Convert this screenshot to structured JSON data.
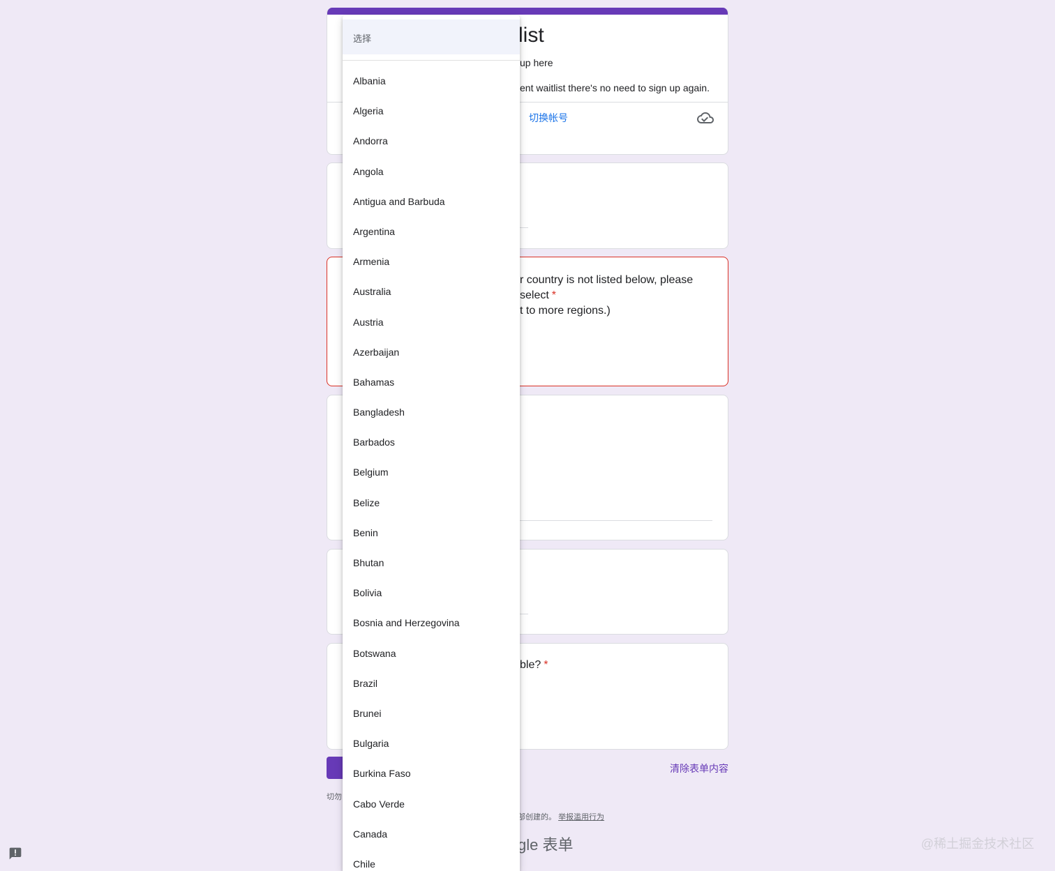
{
  "form": {
    "title_fragment": "list",
    "desc_line1_fragment": "up here",
    "desc_line2_fragment": "ent waitlist there's no need to sign up again.",
    "switch_account": "切换帐号",
    "q3_line1_fragment": "r country is not listed below, please select",
    "q3_line2_fragment": "t to more regions.)",
    "q6_fragment": "ble?",
    "required_star": "*",
    "clear_form": "清除表单内容",
    "never_submit_fragment": "切勿",
    "created_fragment": "部创建的。",
    "report_abuse": "举报滥用行为",
    "google_forms_fragment": "gle 表单"
  },
  "dropdown": {
    "selected_label": "选择",
    "options": [
      "Albania",
      "Algeria",
      "Andorra",
      "Angola",
      "Antigua and Barbuda",
      "Argentina",
      "Armenia",
      "Australia",
      "Austria",
      "Azerbaijan",
      "Bahamas",
      "Bangladesh",
      "Barbados",
      "Belgium",
      "Belize",
      "Benin",
      "Bhutan",
      "Bolivia",
      "Bosnia and Herzegovina",
      "Botswana",
      "Brazil",
      "Brunei",
      "Bulgaria",
      "Burkina Faso",
      "Cabo Verde",
      "Canada",
      "Chile"
    ]
  },
  "watermark": "@稀土掘金技术社区",
  "colors": {
    "brand": "#673ab7",
    "background": "#efe9f6",
    "link": "#1a73e8",
    "error": "#d93025"
  },
  "icons": {
    "cloud": "cloud-saved-icon",
    "feedback": "feedback-icon"
  }
}
